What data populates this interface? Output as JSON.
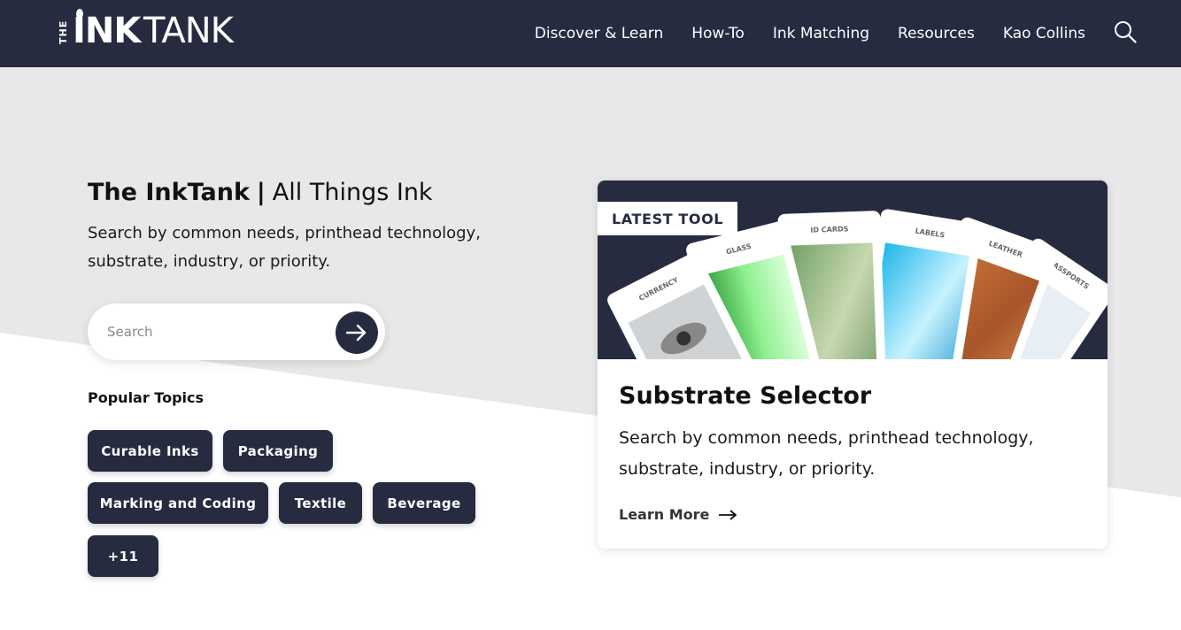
{
  "header": {
    "logo": {
      "the": "THE",
      "ink": "INK",
      "tank": "TANK"
    },
    "nav": [
      {
        "label": "Discover & Learn"
      },
      {
        "label": "How-To"
      },
      {
        "label": "Ink Matching"
      },
      {
        "label": "Resources"
      },
      {
        "label": "Kao Collins"
      }
    ],
    "search_icon": "search-icon"
  },
  "hero": {
    "title_strong": "The InkTank",
    "title_sep": "|",
    "title_light": "All Things Ink",
    "description": "Search by common needs, printhead technology, substrate, industry, or priority.",
    "search": {
      "placeholder": "Search",
      "go_icon": "arrow-right-icon"
    },
    "popular_topics_label": "Popular Topics",
    "topics": [
      {
        "label": "Curable Inks"
      },
      {
        "label": "Packaging"
      },
      {
        "label": "Marking and Coding"
      },
      {
        "label": "Textile"
      },
      {
        "label": "Beverage"
      },
      {
        "label": "+11"
      }
    ]
  },
  "card": {
    "badge": "LATEST TOOL",
    "image_cards": [
      {
        "label": "CURRENCY"
      },
      {
        "label": "GLASS"
      },
      {
        "label": "ID CARDS"
      },
      {
        "label": "LABELS"
      },
      {
        "label": "LEATHER"
      },
      {
        "label": "PASSPORTS"
      }
    ],
    "title": "Substrate Selector",
    "description": "Search by common needs, printhead technology, substrate, industry, or priority.",
    "learn_more": "Learn More"
  },
  "colors": {
    "navy": "#262b40",
    "grey_bg": "#e8e8e9",
    "white": "#ffffff"
  }
}
